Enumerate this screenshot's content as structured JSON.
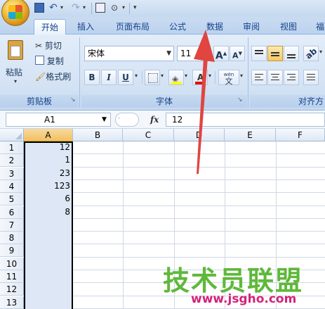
{
  "ribbon": {
    "tabs": [
      "开始",
      "插入",
      "页面布局",
      "公式",
      "数据",
      "审阅",
      "视图",
      "福"
    ],
    "active_tab": "开始",
    "clipboard": {
      "paste": "粘贴",
      "cut": "剪切",
      "copy": "复制",
      "format_painter": "格式刷",
      "group_label": "剪贴板"
    },
    "font": {
      "font_name": "宋体",
      "font_size": "11",
      "grow": "A",
      "shrink": "A",
      "bold": "B",
      "italic": "I",
      "underline": "U",
      "phonetic": "wén",
      "phonetic_char": "文",
      "group_label": "字体"
    },
    "alignment": {
      "group_label": "对齐方"
    }
  },
  "formula_bar": {
    "name_box": "A1",
    "fx": "fx",
    "value": "12"
  },
  "sheet": {
    "columns": [
      "A",
      "B",
      "C",
      "D",
      "E",
      "F"
    ],
    "rows": [
      "1",
      "2",
      "3",
      "4",
      "5",
      "6",
      "7",
      "8",
      "9",
      "10",
      "11",
      "12",
      "13"
    ],
    "column_a_values": [
      "12",
      "1",
      "23",
      "123",
      "6",
      "8"
    ]
  },
  "watermark": {
    "title": "技术员联盟",
    "url": "www.jsgho.com"
  },
  "colors": {
    "accent_arrow": "#e0453f",
    "selection": "#f1c15f",
    "ribbon_text": "#15428b"
  }
}
